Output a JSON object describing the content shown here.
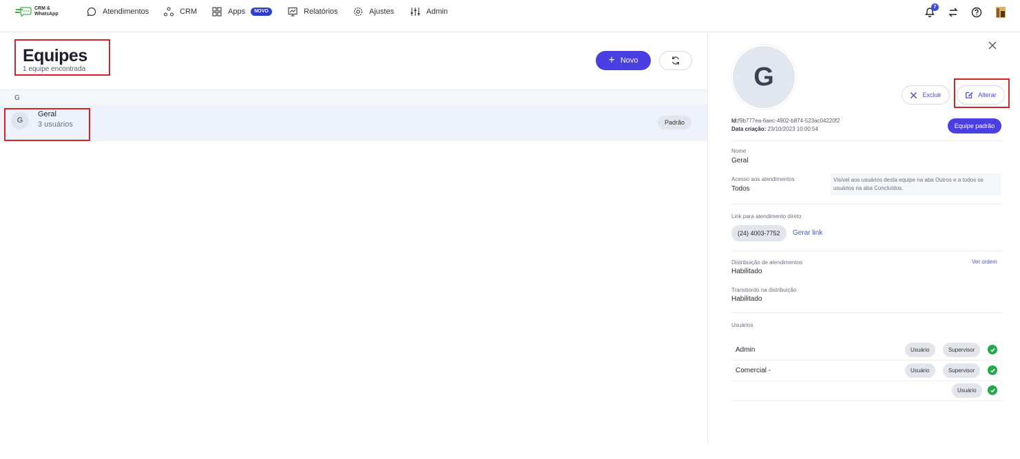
{
  "nav": {
    "logo_text": "CRM &\nWhatsApp",
    "items": [
      {
        "label": "Atendimentos",
        "icon": "chat-icon"
      },
      {
        "label": "CRM",
        "icon": "crm-nodes-icon"
      },
      {
        "label": "Apps",
        "icon": "apps-grid-icon",
        "badge": "NOVO"
      },
      {
        "label": "Relatórios",
        "icon": "report-chart-icon"
      },
      {
        "label": "Ajustes",
        "icon": "gear-icon"
      },
      {
        "label": "Admin",
        "icon": "sliders-icon"
      }
    ],
    "notification_count": "7",
    "accent": "#2f3ec9"
  },
  "page": {
    "title": "Equipes",
    "subtitle": "1 equipe encontrada",
    "new_button": "Novo",
    "group_letter": "G"
  },
  "team_row": {
    "initial": "G",
    "name": "Geral",
    "users": "3 usuários",
    "badge": "Padrão"
  },
  "detail": {
    "initial": "G",
    "delete_button": "Excluir",
    "edit_button": "Alterar",
    "id_label": "Id:",
    "id_value": "f9b777ea-6aec-4902-b874-523ac04220f2",
    "created_label": "Data criação:",
    "created_value": "23/10/2023 10:00:54",
    "default_team_button": "Equipe padrão",
    "name_label": "Nome",
    "name_value": "Geral",
    "access_label": "Acesso aos atendimentos",
    "access_value": "Todos",
    "access_note": "Visível aos usuários desta equipe na aba Outros e a todos os usuários na aba Concluídos.",
    "link_label": "Link para atendimento direto",
    "phone": "(24) 4003-7752",
    "generate_link": "Gerar link",
    "distribution_label": "Distribuição de atendimentos",
    "distribution_value": "Habilitado",
    "view_order": "Ver ordem",
    "overflow_label": "Transbordo na distribuição",
    "overflow_value": "Habilitado",
    "users_label": "Usuários",
    "users": [
      {
        "name": "Admin",
        "chips": [
          "Usuário",
          "Supervisor"
        ]
      },
      {
        "name": "Comercial -",
        "chips": [
          "Usuário",
          "Supervisor"
        ]
      },
      {
        "name": "",
        "chips": [
          "Usuário"
        ]
      }
    ]
  }
}
